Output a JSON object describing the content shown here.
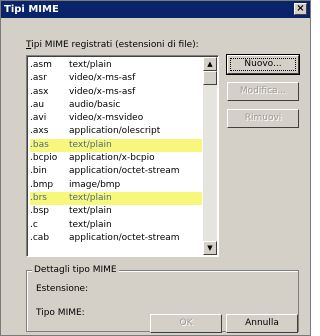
{
  "window": {
    "title": "Tipi MIME",
    "close_glyph": "×"
  },
  "list": {
    "label_prefix": "T",
    "label_rest": "ipi MIME registrati (estensioni di file):",
    "items": [
      {
        "ext": ".asm",
        "mime": "text/plain",
        "highlighted": false
      },
      {
        "ext": ".asr",
        "mime": "video/x-ms-asf",
        "highlighted": false
      },
      {
        "ext": ".asx",
        "mime": "video/x-ms-asf",
        "highlighted": false
      },
      {
        "ext": ".au",
        "mime": "audio/basic",
        "highlighted": false
      },
      {
        "ext": ".avi",
        "mime": "video/x-msvideo",
        "highlighted": false
      },
      {
        "ext": ".axs",
        "mime": "application/olescript",
        "highlighted": false
      },
      {
        "ext": ".bas",
        "mime": "text/plain",
        "highlighted": true
      },
      {
        "ext": ".bcpio",
        "mime": "application/x-bcpio",
        "highlighted": false
      },
      {
        "ext": ".bin",
        "mime": "application/octet-stream",
        "highlighted": false
      },
      {
        "ext": ".bmp",
        "mime": "image/bmp",
        "highlighted": false
      },
      {
        "ext": ".brs",
        "mime": "text/plain",
        "highlighted": true
      },
      {
        "ext": ".bsp",
        "mime": "text/plain",
        "highlighted": false
      },
      {
        "ext": ".c",
        "mime": "text/plain",
        "highlighted": false
      },
      {
        "ext": ".cab",
        "mime": "application/octet-stream",
        "highlighted": false
      }
    ]
  },
  "buttons": {
    "new": "Nuovo...",
    "edit": "Modifica...",
    "remove": "Rimuovi",
    "ok": "OK",
    "cancel": "Annulla"
  },
  "details": {
    "group_title": "Dettagli tipo MIME",
    "extension_label": "Estensione:",
    "mime_label": "Tipo MIME:"
  },
  "colors": {
    "titlebar": "#0a246a",
    "dialog": "#d4d0c8",
    "highlight": "#f7f77c"
  }
}
